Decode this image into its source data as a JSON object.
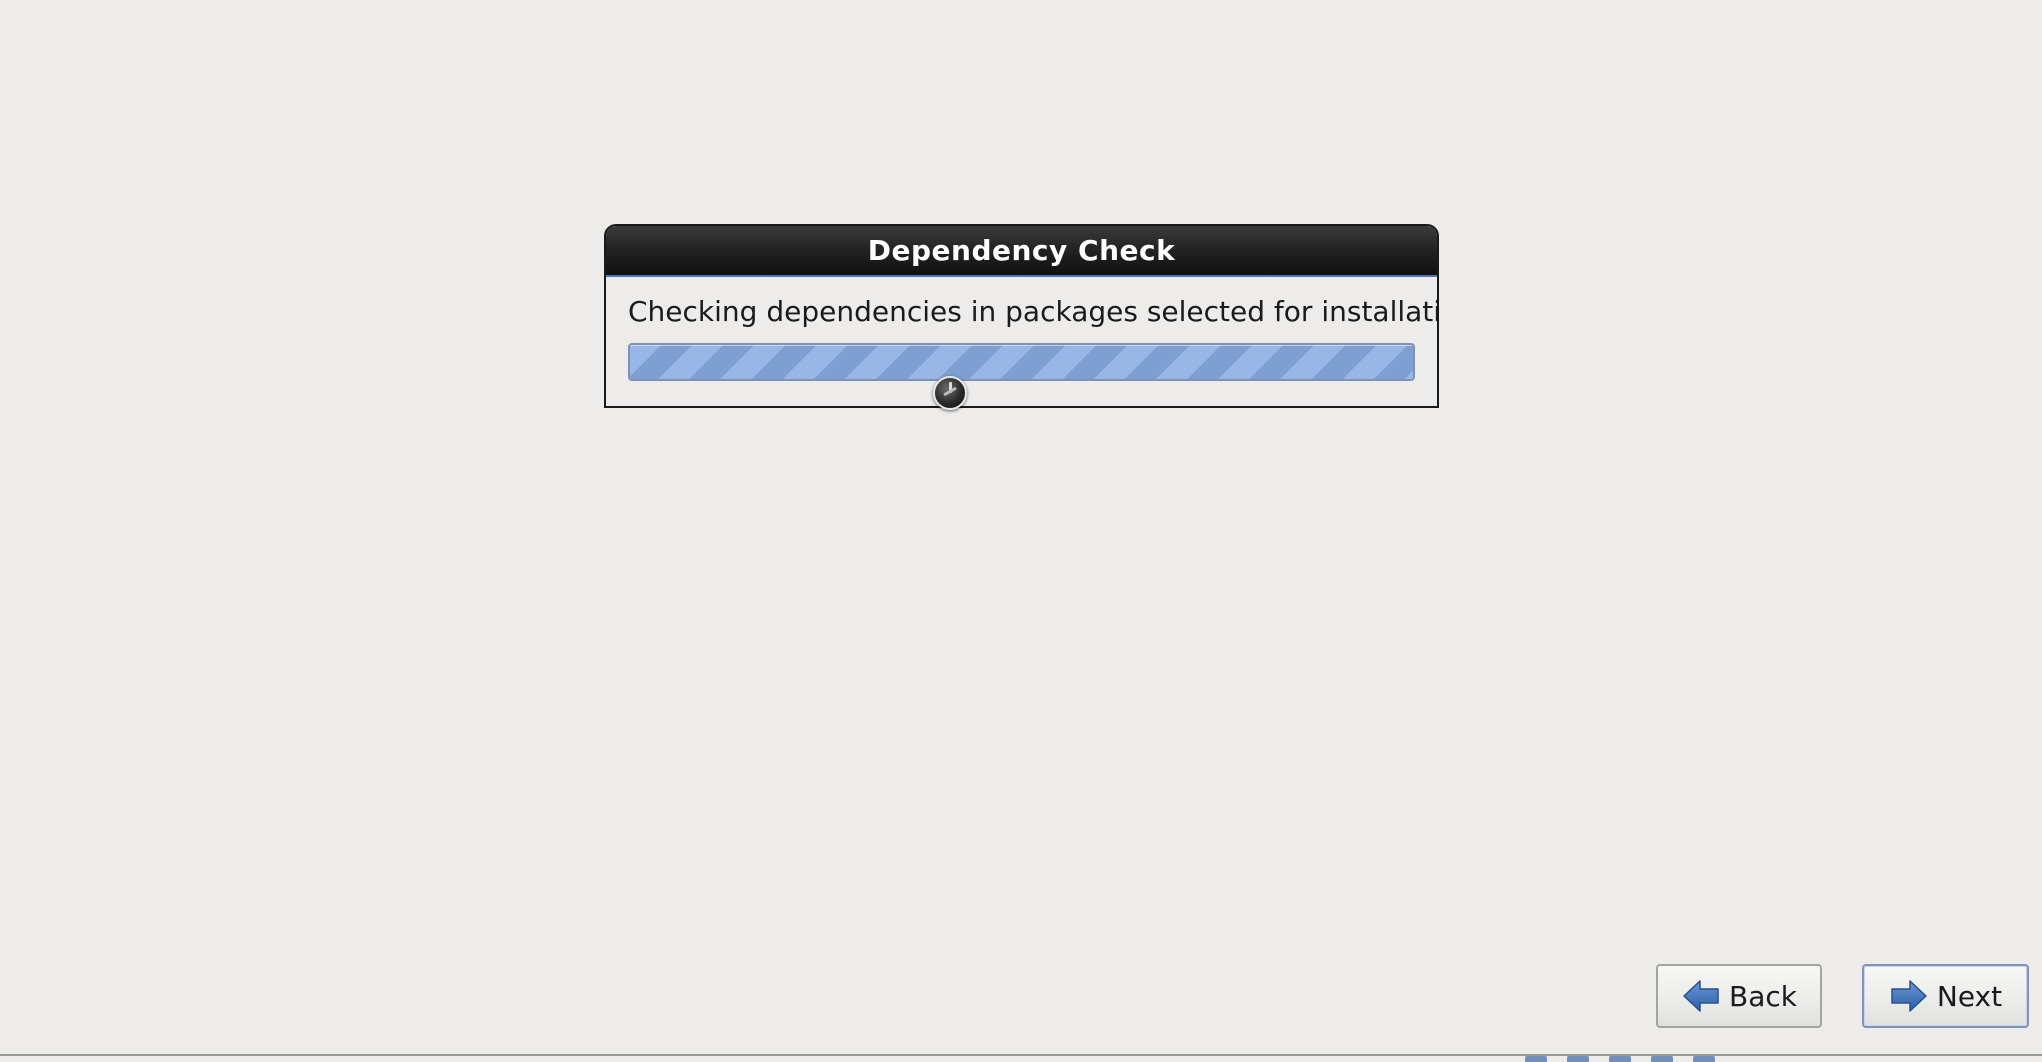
{
  "dialog": {
    "title": "Dependency Check",
    "message": "Checking dependencies in packages selected for installation",
    "progress": 1.0
  },
  "buttons": {
    "back_label": "Back",
    "next_label": "Next"
  },
  "colors": {
    "background": "#edecea",
    "titlebar": "#1e1e1e",
    "progress_fill": "#90afe0",
    "arrow": "#3d6fb4"
  },
  "icons": {
    "back": "arrow-left-icon",
    "next": "arrow-right-icon",
    "cursor": "busy-cursor-icon"
  }
}
